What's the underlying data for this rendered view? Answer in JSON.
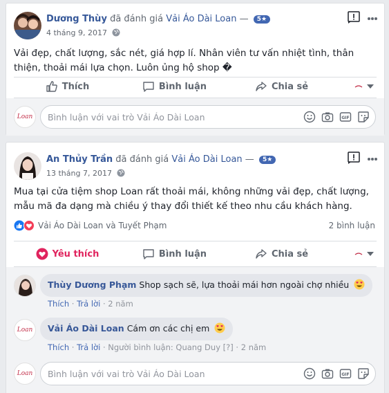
{
  "posts": [
    {
      "author": "Dương Thùy",
      "action": "đã đánh giá",
      "page": "Vải Áo Dài Loan",
      "dash": "—",
      "rating": "5★",
      "date": "4 tháng 9, 2017",
      "text": "Vải đẹp, chất lượng, sắc nét, giá hợp lí. Nhân viên tư vấn nhiệt tình, thân thiện, thoải mái lựa chọn. Luôn ủng hộ shop �",
      "actions": {
        "like": "Thích",
        "comment": "Bình luận",
        "share": "Chia sẻ"
      },
      "comment_placeholder": "Bình luận với vai trò Vải Áo Dài Loan"
    },
    {
      "author": "An Thủy Trần",
      "action": "đã đánh giá",
      "page": "Vải Áo Dài Loan",
      "dash": "—",
      "rating": "5★",
      "date": "13 tháng 7, 2017",
      "text": "Mua tại cửa tiệm shop Loan rất thoải mái, không những vải đẹp, chất lượng, mẫu mã đa dạng mà chiều ý thay đổi thiết kế theo nhu cầu khách hàng.",
      "reactions_text": "Vải Áo Dài Loan và Tuyết Phạm",
      "comments_count": "2 bình luận",
      "actions": {
        "like": "Yêu thích",
        "comment": "Bình luận",
        "share": "Chia sẻ"
      },
      "comments": [
        {
          "name": "Thùy Dương Phạm",
          "text": "Shop sạch sẽ, lựa thoải mái hơn ngoài chợ nhiều",
          "like": "Thích",
          "reply": "Trả lời",
          "sep": "·",
          "time": "2 năm"
        },
        {
          "name": "Vải Áo Dài Loan",
          "text": "Cám ơn các chị em",
          "like": "Thích",
          "reply": "Trả lời",
          "sep": "·",
          "commenter": "Người bình luận: Quang Duy",
          "help": "[?]",
          "time": "2 năm"
        }
      ],
      "comment_placeholder": "Bình luận với vai trò Vải Áo Dài Loan"
    }
  ],
  "brand_logo_text": "Loan",
  "colors": {
    "link": "#365899",
    "love": "#e0245e",
    "badge": "#4267b2",
    "like_blue": "#1877f2"
  }
}
